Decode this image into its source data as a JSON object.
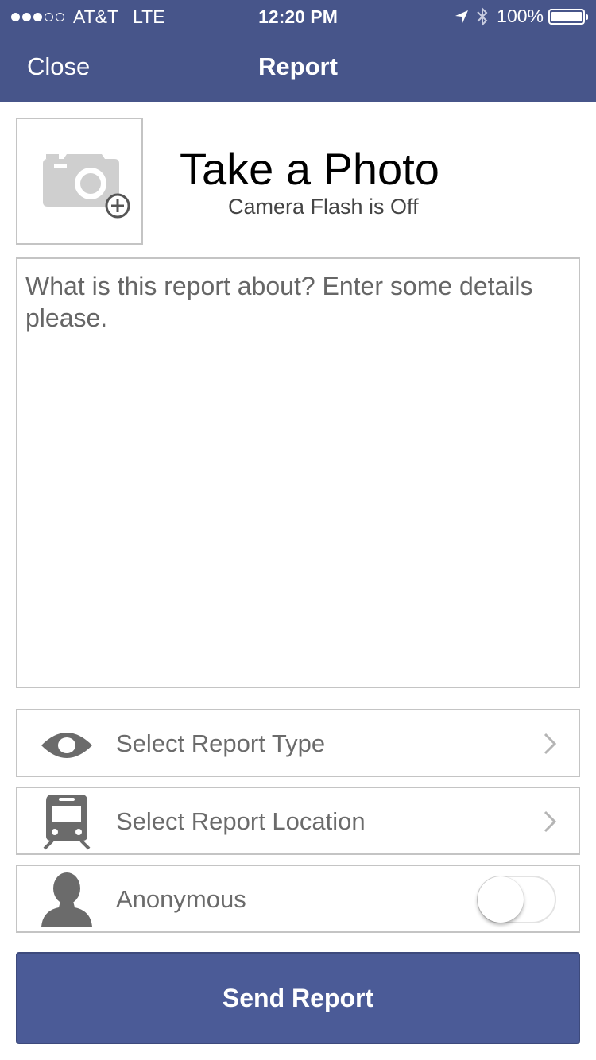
{
  "status_bar": {
    "carrier": "AT&T",
    "network": "LTE",
    "time": "12:20 PM",
    "battery": "100%",
    "signal_bars_filled": 3,
    "signal_bars_total": 5,
    "icons": [
      "location-arrow-icon",
      "bluetooth-icon",
      "battery-icon"
    ]
  },
  "nav": {
    "close_label": "Close",
    "title": "Report"
  },
  "photo": {
    "title": "Take a Photo",
    "subtitle": "Camera Flash is Off",
    "icon": "camera-add-icon"
  },
  "details": {
    "placeholder": "What is this report about? Enter some details please.",
    "value": ""
  },
  "options": {
    "report_type": {
      "label": "Select Report Type",
      "icon": "eye-icon"
    },
    "report_location": {
      "label": "Select Report Location",
      "icon": "train-icon"
    },
    "anonymous": {
      "label": "Anonymous",
      "icon": "person-icon",
      "enabled": false
    }
  },
  "send_label": "Send Report",
  "colors": {
    "header": "#47558a",
    "button": "#4b5b97",
    "border": "#c4c4c4",
    "icon_gray": "#6b6b6b"
  }
}
